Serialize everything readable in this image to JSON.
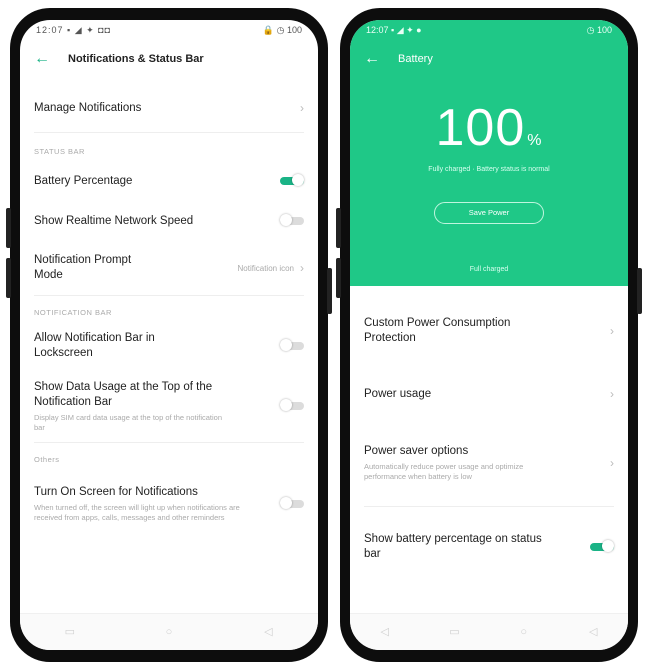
{
  "left_screen": {
    "status_time": "12:07",
    "status_left": "12:07 ▪ ◢ ✦ ◘◘",
    "status_right": "🔒 ◷ 100",
    "title": "Notifications & Status Bar",
    "manage": "Manage Notifications",
    "section_status_bar": "STATUS BAR",
    "battery_percentage": "Battery Percentage",
    "battery_percentage_on": true,
    "realtime_speed": "Show Realtime Network Speed",
    "realtime_speed_on": false,
    "prompt_mode": "Notification Prompt Mode",
    "prompt_mode_value": "Notification icon",
    "section_notification_bar": "NOTIFICATION BAR",
    "allow_lockscreen": "Allow Notification Bar in Lockscreen",
    "allow_lockscreen_on": false,
    "data_usage": "Show Data Usage at the Top of the Notification Bar",
    "data_usage_sub": "Display SIM card data usage at the top of the notification bar",
    "data_usage_on": false,
    "section_others": "Others",
    "turn_on_screen": "Turn On Screen for Notifications",
    "turn_on_screen_sub": "When turned off, the screen will light up when notifications are received from apps, calls, messages and other reminders",
    "turn_on_screen_on": false
  },
  "right_screen": {
    "status_left": "12:07 ▪ ◢ ✦ ●",
    "status_right": "◷ 100",
    "title": "Battery",
    "percentage": "100",
    "percent_symbol": "%",
    "subtitle": "Fully charged · Battery status is normal",
    "saver_button": "Save Power",
    "full_charged": "Full charged",
    "custom_power": "Custom Power Consumption Protection",
    "power_usage": "Power usage",
    "saver_options": "Power saver options",
    "saver_options_sub": "Automatically reduce power usage and optimize performance when battery is low",
    "show_percentage": "Show battery percentage on status bar",
    "show_percentage_on": true
  },
  "accent_color": "#1fc887"
}
